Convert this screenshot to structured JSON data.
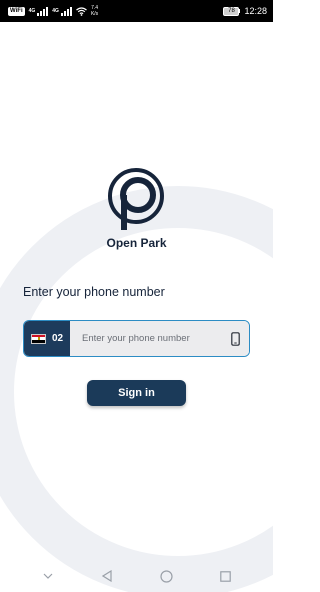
{
  "status_bar": {
    "wifi_badge": "WiFi",
    "sig1_sup": "4G",
    "sig2_sup": "4G",
    "speed_value": "7.4",
    "speed_unit": "K/s",
    "battery": "78",
    "time": "12:28"
  },
  "app": {
    "name": "Open Park",
    "logo_icon": "open-park-logo"
  },
  "login": {
    "prompt": "Enter your phone number",
    "country_flag": "egypt-flag-icon",
    "country_code": "02",
    "phone_placeholder": "Enter your phone number",
    "phone_value": "",
    "trailing_icon": "mobile-phone-icon",
    "sign_in_label": "Sign in"
  },
  "nav_bar": {
    "items": [
      "collapse-icon",
      "back-icon",
      "home-icon",
      "recents-icon"
    ]
  },
  "colors": {
    "primary": "#1b3a59",
    "accent_border": "#2c8cc4",
    "input_bg": "#ececee",
    "ring": "#eef0f4"
  }
}
